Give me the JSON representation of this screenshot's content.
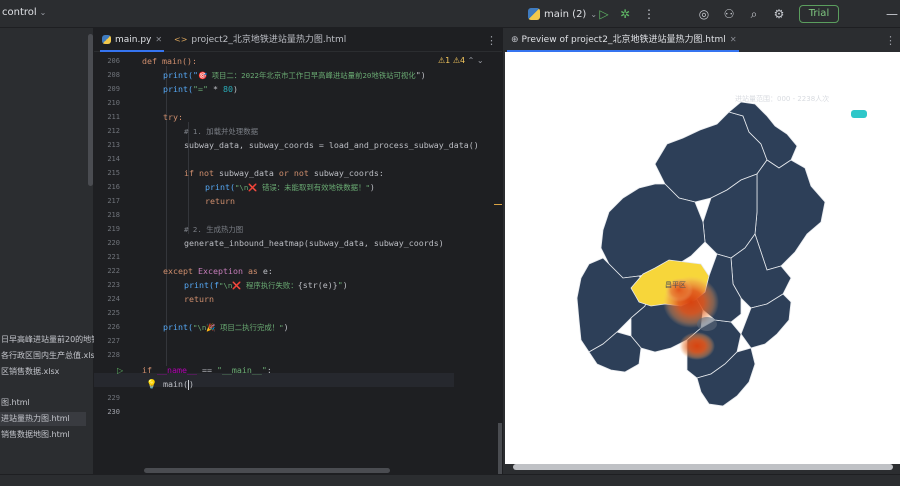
{
  "project": {
    "name": "control"
  },
  "run_config": {
    "label": "main (2)"
  },
  "toolbar_icons": [
    "run-icon",
    "debug-icon",
    "more-icon",
    "ai-assistant-icon",
    "add-user-icon",
    "search-icon",
    "settings-icon"
  ],
  "trial": {
    "label": "Trial"
  },
  "sidebar": {
    "files": [
      {
        "label": "日早高峰进站量前20的地铁站",
        "selected": false
      },
      {
        "label": "各行政区国内生产总值.xlsx",
        "selected": false
      },
      {
        "label": "区销售数据.xlsx",
        "selected": false
      },
      {
        "label": "图.html",
        "selected": false
      },
      {
        "label": "进站量热力图.html",
        "selected": true
      },
      {
        "label": "销售数据地图.html",
        "selected": false
      }
    ]
  },
  "editor": {
    "tabs": [
      {
        "label": "main.py",
        "active": true
      },
      {
        "label": "project2_北京地铁进站量热力图.html",
        "active": false
      }
    ],
    "inspections": {
      "warnings": "1",
      "weak_warnings": "4"
    },
    "line_numbers": [
      "206",
      "208",
      "209",
      "210",
      "211",
      "212",
      "213",
      "214",
      "215",
      "216",
      "217",
      "218",
      "219",
      "220",
      "221",
      "222",
      "223",
      "224",
      "225",
      "226",
      "227",
      "228",
      "229",
      "230"
    ],
    "current_line": "230",
    "sticky_header": "def main():",
    "code": {
      "l208_a": "print(\"",
      "l208_b": "🎯 项目二：2022年北京市工作日早高峰进站量前20地铁站可视化",
      "l208_c": "\")",
      "l209_a": "print(",
      "l209_b": "\"=\"",
      "l209_c": " * ",
      "l209_d": "80",
      "l209_e": ")",
      "l211": "try:",
      "l212": "# 1. 加载并处理数据",
      "l213": "subway_data, subway_coords = load_and_process_subway_data()",
      "l215_a": "if not",
      "l215_b": " subway_data ",
      "l215_c": "or not",
      "l215_d": " subway_coords:",
      "l216_a": "print(",
      "l216_b": "\"\\n❌ 错误：未能取到有效地铁数据！\"",
      "l216_c": ")",
      "l217": "return",
      "l219": "# 2. 生成热力图",
      "l220_a": "generate_inbound_heatmap",
      "l220_b": "(subway_data, subway_coords)",
      "l222_a": "except",
      "l222_b": " Exception ",
      "l222_c": "as",
      "l222_d": " e:",
      "l223_a": "print(f",
      "l223_b": "\"\\n❌ 程序执行失败：",
      "l223_c": "{str(e)}",
      "l223_d": "\"",
      "l223_e": ")",
      "l224": "return",
      "l226_a": "print(",
      "l226_b": "\"\\n🎉 项目二执行完成！\"",
      "l226_c": ")",
      "l229_a": "if",
      "l229_b": " __name__ ",
      "l229_c": "==",
      "l229_d": " \"__main__\"",
      "l229_e": ":",
      "l230_a": "main(",
      "l230_b": ")"
    }
  },
  "preview": {
    "tab_label": "Preview of project2_北京地铁进站量热力图.html",
    "legend_text": "进站量范围：000 - 2238人次",
    "map_label": "昌平区",
    "legend_color": "#2ec7c9"
  },
  "colors": {
    "map_fill": "#2d3f58",
    "map_border": "#e7eaee",
    "highlight": "#f7d63a",
    "heat": "#e0581f"
  }
}
